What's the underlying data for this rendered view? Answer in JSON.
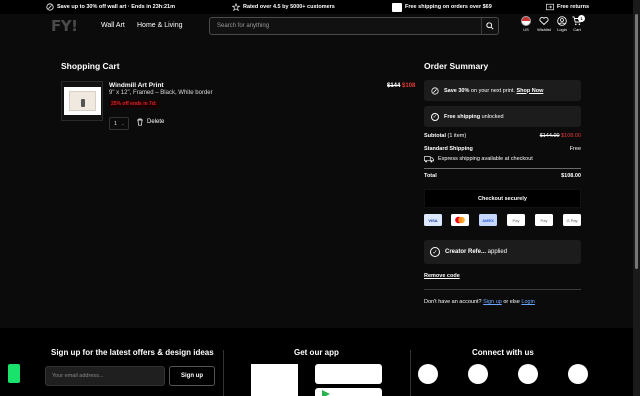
{
  "promo": {
    "sale_text": "Save up to 30% off wall art · Ends in 23h:21m",
    "rating_text": "Rated over 4.5 by 5000+ customers",
    "shipping_text": "Free shipping on orders over $69",
    "returns_text": "Free returns"
  },
  "header": {
    "logo": "FY!",
    "nav": [
      "Wall Art",
      "Home & Living"
    ],
    "search_placeholder": "Search for anything",
    "icons": {
      "country": "US",
      "wishlist": "Wishlist",
      "login": "Login",
      "cart": "Cart",
      "cart_count": "1"
    }
  },
  "cart": {
    "title": "Shopping Cart",
    "item": {
      "name": "Windmill Art Print",
      "description": "9\" x 12\", Framed – Black, White border",
      "discount_tag": "25% off ends in 7d:",
      "quantity": "1",
      "delete_label": "Delete",
      "old_price": "$144",
      "new_price": "$108"
    }
  },
  "summary": {
    "title": "Order Summary",
    "promo_banner": {
      "bold": "Save 30%",
      "text": " on your next print. ",
      "link": "Shop Now"
    },
    "free_shipping": {
      "bold": "Free shipping",
      "text": " unlocked"
    },
    "subtotal_label": "Subtotal",
    "subtotal_items": "(1 item)",
    "subtotal_old": "$144.00",
    "subtotal_new": "$108.00",
    "shipping_label": "Standard Shipping",
    "shipping_value": "Free",
    "express_text": "Express shipping available at checkout",
    "total_label": "Total",
    "total_value": "$108.00",
    "checkout_label": "Checkout securely",
    "payment_methods": [
      "VISA",
      "MC",
      "AMEX",
      "Pay",
      "Pay",
      "G Pay"
    ],
    "creator_code": {
      "bold": "Creator Refe...",
      "text": " applied"
    },
    "remove_code": "Remove code",
    "account_prompt": "Don't have an account?",
    "signup_link": "Sign up",
    "or_else": "or else",
    "login_link": "Login"
  },
  "footer": {
    "signup_heading": "Sign up for the latest offers & design ideas",
    "email_placeholder": "Your email address...",
    "signup_button": "Sign up",
    "app_heading": "Get our app",
    "connect_heading": "Connect with us"
  },
  "colors": {
    "background": "#0b0b0b",
    "sale_red": "#e53935",
    "link_blue": "#6aa6ff",
    "accent_green": "#19e36a"
  }
}
